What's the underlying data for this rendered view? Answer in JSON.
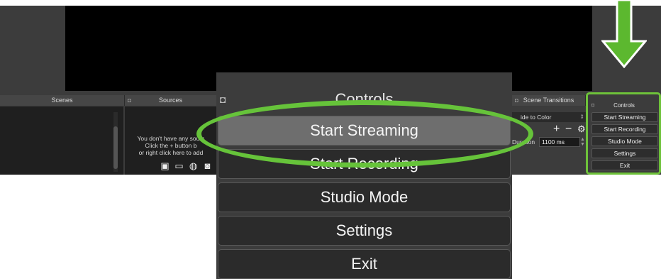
{
  "colors": {
    "annotation_green": "#6ec23a",
    "panel_bg": "#3c3c3c",
    "button_bg": "#2b2b2b",
    "hover_bg": "#6e6e6e"
  },
  "docks": {
    "scenes_title": "Scenes",
    "sources_title": "Sources",
    "sources_hint": [
      "You don't have any sourc",
      "Click the + button b",
      "or right click here to add"
    ],
    "source_icons": [
      "image-icon",
      "display-icon",
      "globe-icon",
      "camera-icon"
    ],
    "scene_transitions": {
      "title": "Scene Transitions",
      "transition": "ide to Color",
      "duration_label": "Duration",
      "duration_value": "1100 ms"
    }
  },
  "mini_controls": {
    "title": "Controls",
    "buttons": [
      "Start Streaming",
      "Start Recording",
      "Studio Mode",
      "Settings",
      "Exit"
    ]
  },
  "zoomed_controls": {
    "title": "Controls",
    "buttons": [
      "Start Streaming",
      "Start Recording",
      "Studio Mode",
      "Settings",
      "Exit"
    ],
    "highlighted": "Start Streaming"
  }
}
